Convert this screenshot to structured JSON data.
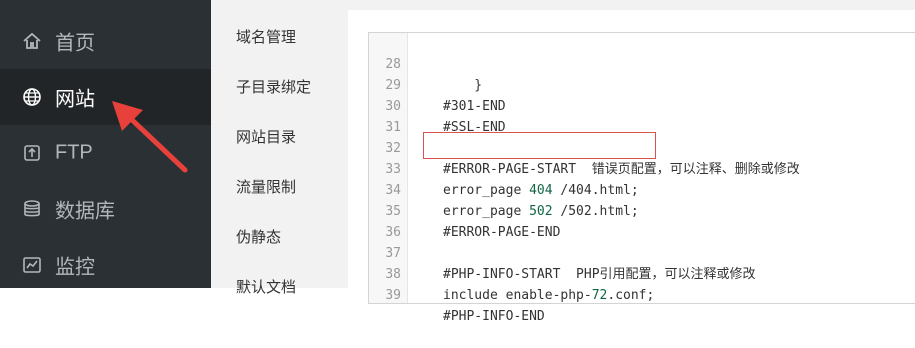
{
  "sidebar": {
    "items": [
      {
        "label": "首页",
        "icon": "home-icon"
      },
      {
        "label": "网站",
        "icon": "globe-icon",
        "active": true
      },
      {
        "label": "FTP",
        "icon": "ftp-icon"
      },
      {
        "label": "数据库",
        "icon": "database-icon"
      },
      {
        "label": "监控",
        "icon": "monitor-icon"
      }
    ]
  },
  "submenu": {
    "items": [
      {
        "label": "域名管理"
      },
      {
        "label": "子目录绑定"
      },
      {
        "label": "网站目录"
      },
      {
        "label": "流量限制"
      },
      {
        "label": "伪静态"
      },
      {
        "label": "默认文档"
      }
    ]
  },
  "editor": {
    "lines": [
      {
        "n": "28",
        "pre": "    }",
        "num": "",
        "post": ""
      },
      {
        "n": "29",
        "pre": "#301-END",
        "num": "",
        "post": ""
      },
      {
        "n": "30",
        "pre": "#SSL-END",
        "num": "",
        "post": ""
      },
      {
        "n": "31",
        "pre": "",
        "num": "",
        "post": ""
      },
      {
        "n": "32",
        "pre": "#ERROR-PAGE-START  错误页配置，可以注释、删除或修改",
        "num": "",
        "post": ""
      },
      {
        "n": "33",
        "pre": "error_page ",
        "num": "404",
        "post": " /404.html;"
      },
      {
        "n": "34",
        "pre": "error_page ",
        "num": "502",
        "post": " /502.html;"
      },
      {
        "n": "35",
        "pre": "#ERROR-PAGE-END",
        "num": "",
        "post": ""
      },
      {
        "n": "36",
        "pre": "",
        "num": "",
        "post": ""
      },
      {
        "n": "37",
        "pre": "#PHP-INFO-START  PHP引用配置，可以注释或修改",
        "num": "",
        "post": ""
      },
      {
        "n": "38",
        "pre": "include enable-php-",
        "num": "72",
        "post": ".conf;"
      },
      {
        "n": "39",
        "pre": "#PHP-INFO-END",
        "num": "",
        "post": ""
      }
    ]
  },
  "colors": {
    "sidebar_bg": "#2b3035",
    "sidebar_active_bg": "#222528",
    "highlight": "#d9534f",
    "arrow": "#e8413b",
    "number": "#116644"
  }
}
